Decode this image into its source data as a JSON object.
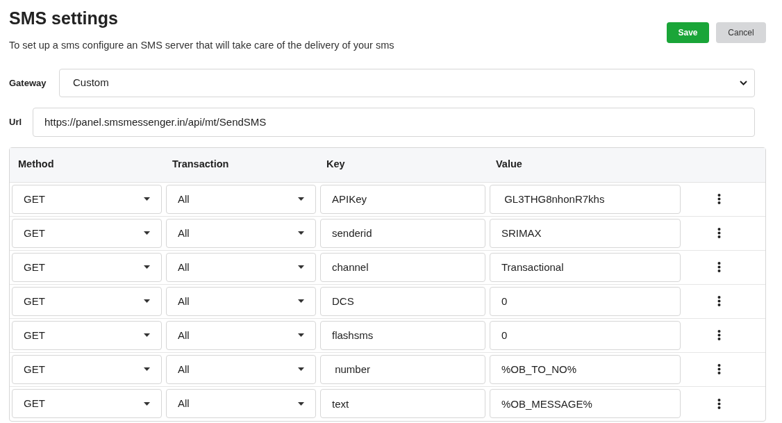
{
  "title": "SMS settings",
  "subtitle": "To set up a sms configure an SMS server that will take care of the delivery of your sms",
  "buttons": [
    {
      "label": "Save",
      "kind": "primary"
    },
    {
      "label": "Cancel",
      "kind": "secondary"
    }
  ],
  "gateway": {
    "label": "Gateway",
    "value": "Custom"
  },
  "url": {
    "label": "Url",
    "value": "https://panel.smsmessenger.in/api/mt/SendSMS"
  },
  "table": {
    "columns": [
      "Method",
      "Transaction",
      "Key",
      "Value"
    ],
    "rows": [
      {
        "method": "GET",
        "transaction": "All",
        "key": "APIKey",
        "value": " GL3THG8nhonR7khs"
      },
      {
        "method": "GET",
        "transaction": "All",
        "key": "senderid",
        "value": "SRIMAX"
      },
      {
        "method": "GET",
        "transaction": "All",
        "key": "channel",
        "value": "Transactional"
      },
      {
        "method": "GET",
        "transaction": "All",
        "key": "DCS",
        "value": "0"
      },
      {
        "method": "GET",
        "transaction": "All",
        "key": "flashsms",
        "value": "0"
      },
      {
        "method": "GET",
        "transaction": "All",
        "key": " number",
        "value": "%OB_TO_NO%"
      },
      {
        "method": "GET",
        "transaction": "All",
        "key": "text",
        "value": "%OB_MESSAGE%"
      }
    ]
  }
}
